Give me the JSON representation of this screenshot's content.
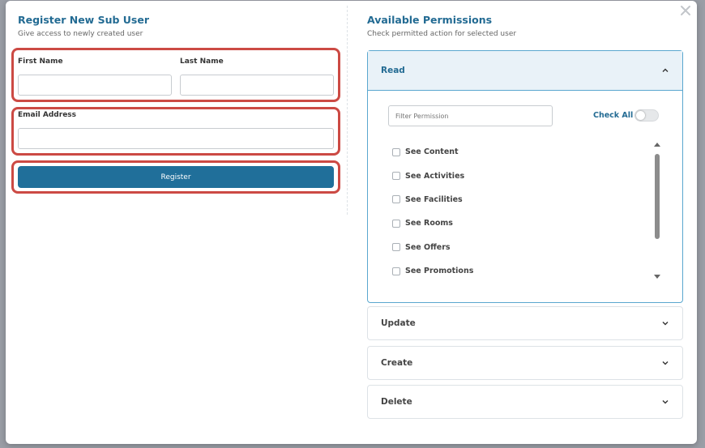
{
  "register": {
    "title": "Register New Sub User",
    "subtitle": "Give access to newly created user",
    "first_name_label": "First Name",
    "first_name_value": "",
    "last_name_label": "Last Name",
    "last_name_value": "",
    "email_label": "Email Address",
    "email_value": "",
    "submit_label": "Register"
  },
  "permissions": {
    "title": "Available Permissions",
    "subtitle": "Check permitted action for selected user",
    "sections": [
      {
        "label": "Read",
        "expanded": true
      },
      {
        "label": "Update",
        "expanded": false
      },
      {
        "label": "Create",
        "expanded": false
      },
      {
        "label": "Delete",
        "expanded": false
      }
    ],
    "filter_placeholder": "Filter Permission",
    "check_all_label": "Check All",
    "check_all_on": false,
    "read_items": [
      "See Content",
      "See Activities",
      "See Facilities",
      "See Rooms",
      "See Offers",
      "See Promotions"
    ]
  },
  "icons": {
    "close": "close-icon",
    "chevron_up": "chevron-up-icon",
    "chevron_down": "chevron-down-icon"
  },
  "colors": {
    "accent": "#236b93",
    "button": "#206f9a",
    "highlight": "#cc4a44"
  }
}
